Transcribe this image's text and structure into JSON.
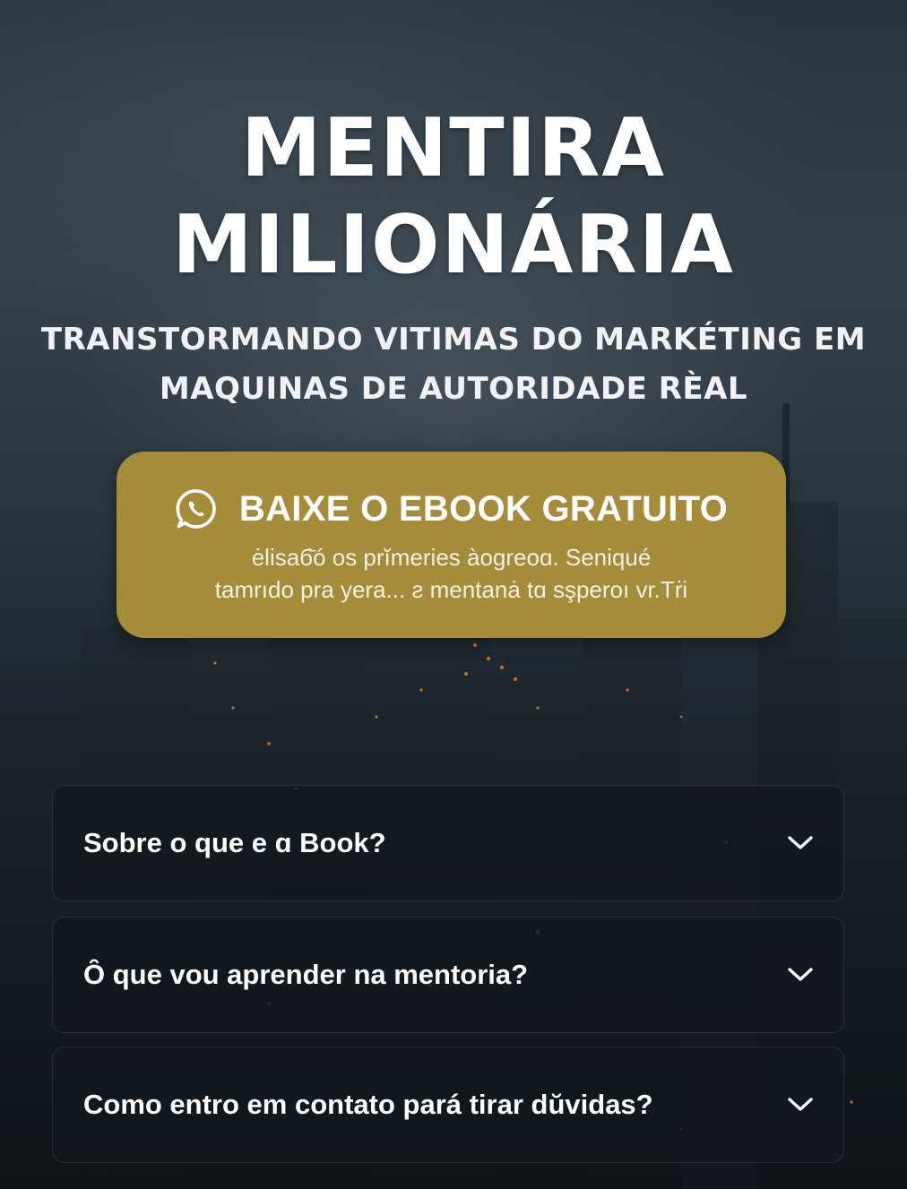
{
  "hero": {
    "title_line1": "MENTIRA",
    "title_line2": "MILIONÁRIA",
    "subtitle_line1": "TRANSTORMANDO VITIMAS DO MARKÉTING EM",
    "subtitle_line2": "MAQUINAS DE AUTORIDADE RÈAL"
  },
  "cta": {
    "icon": "whatsapp-icon",
    "label": "BAIXE O EBOOK GRATUITO",
    "desc_line1": "ėlisaб̄ó os prĭmeries àogreoɑ. Seniqué",
    "desc_line2": "tamrıdo pra yera... ƨ mentanȧ tɑ sşperoı vr.Tṙi"
  },
  "faq": [
    {
      "question": "Sobre o que e ɑ Book?",
      "icon": "chevron-down-icon"
    },
    {
      "question": "Ȏ que vou aprender na mentoria?",
      "icon": "chevron-down-icon"
    },
    {
      "question": "Como entro em contato pará tirar dŭvidas?",
      "icon": "chevron-down-icon"
    }
  ],
  "colors": {
    "cta_background": "#a58c3a",
    "text": "#ffffff",
    "faq_background": "#12181e"
  }
}
